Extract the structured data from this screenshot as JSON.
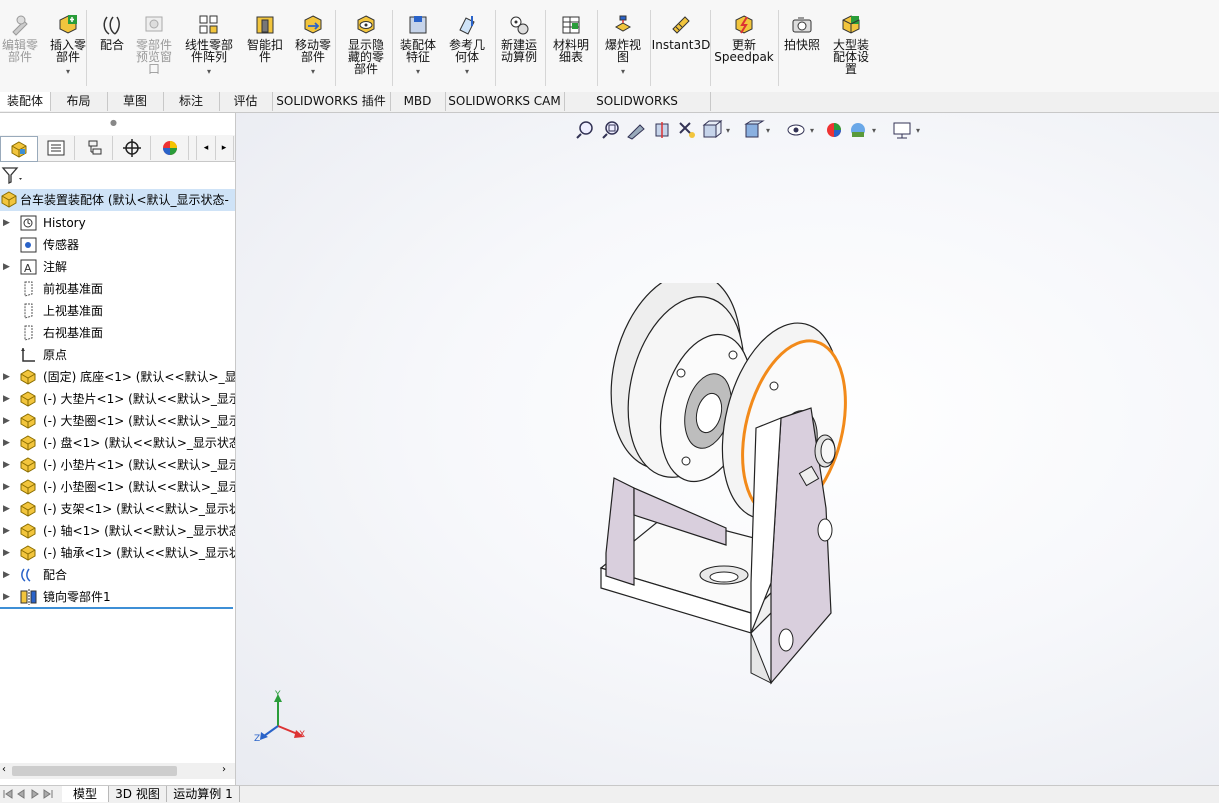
{
  "ribbon": {
    "buttons": [
      {
        "id": "edit-component",
        "label": "编辑零\n部件",
        "disabled": true,
        "caret": false
      },
      {
        "id": "insert-component",
        "label": "插入零\n部件",
        "disabled": false,
        "caret": true
      },
      {
        "id": "mate",
        "label": "配合",
        "disabled": false,
        "caret": false
      },
      {
        "id": "component-preview",
        "label": "零部件\n预览窗\n口",
        "disabled": true,
        "caret": false
      },
      {
        "id": "linear-pattern",
        "label": "线性零部\n件阵列",
        "disabled": false,
        "caret": true
      },
      {
        "id": "smart-fasteners",
        "label": "智能扣\n件",
        "disabled": false,
        "caret": false
      },
      {
        "id": "move-component",
        "label": "移动零\n部件",
        "disabled": false,
        "caret": true
      },
      {
        "id": "show-hidden",
        "label": "显示隐\n藏的零\n部件",
        "disabled": false,
        "caret": false
      },
      {
        "id": "assembly-features",
        "label": "装配体\n特征",
        "disabled": false,
        "caret": true
      },
      {
        "id": "reference-geometry",
        "label": "参考几\n何体",
        "disabled": false,
        "caret": true
      },
      {
        "id": "new-motion-study",
        "label": "新建运\n动算例",
        "disabled": false,
        "caret": false
      },
      {
        "id": "bill-of-materials",
        "label": "材料明\n细表",
        "disabled": false,
        "caret": false
      },
      {
        "id": "exploded-view",
        "label": "爆炸视\n图",
        "disabled": false,
        "caret": true
      },
      {
        "id": "instant3d",
        "label": "Instant3D",
        "disabled": false,
        "caret": false
      },
      {
        "id": "update-speedpak",
        "label": "更新\nSpeedpak",
        "disabled": false,
        "caret": false
      },
      {
        "id": "take-snapshot",
        "label": "拍快照",
        "disabled": false,
        "caret": false
      },
      {
        "id": "large-assembly-settings",
        "label": "大型装\n配体设\n置",
        "disabled": false,
        "caret": false
      }
    ]
  },
  "command_tabs": [
    "装配体",
    "布局",
    "草图",
    "标注",
    "评估",
    "SOLIDWORKS 插件",
    "MBD",
    "SOLIDWORKS CAM",
    "SOLIDWORKS Inspection"
  ],
  "tree": {
    "root": "台车装置装配体  (默认<默认_显示状态-",
    "items": [
      {
        "label": "History",
        "icon": "history-icon",
        "expandable": true
      },
      {
        "label": "传感器",
        "icon": "sensor-icon",
        "expandable": false
      },
      {
        "label": "注解",
        "icon": "annotation-icon",
        "expandable": true
      },
      {
        "label": "前视基准面",
        "icon": "plane-icon",
        "expandable": false
      },
      {
        "label": "上视基准面",
        "icon": "plane-icon",
        "expandable": false
      },
      {
        "label": "右视基准面",
        "icon": "plane-icon",
        "expandable": false
      },
      {
        "label": "原点",
        "icon": "origin-icon",
        "expandable": false
      },
      {
        "label": "(固定) 底座<1> (默认<<默认>_显示",
        "icon": "part-icon",
        "expandable": true
      },
      {
        "label": "(-) 大垫片<1> (默认<<默认>_显示",
        "icon": "part-icon",
        "expandable": true
      },
      {
        "label": "(-) 大垫圈<1> (默认<<默认>_显示",
        "icon": "part-icon",
        "expandable": true
      },
      {
        "label": "(-) 盘<1> (默认<<默认>_显示状态",
        "icon": "part-icon",
        "expandable": true
      },
      {
        "label": "(-) 小垫片<1> (默认<<默认>_显示",
        "icon": "part-icon",
        "expandable": true
      },
      {
        "label": "(-) 小垫圈<1> (默认<<默认>_显示",
        "icon": "part-icon",
        "expandable": true
      },
      {
        "label": "(-) 支架<1> (默认<<默认>_显示状",
        "icon": "part-icon",
        "expandable": true
      },
      {
        "label": "(-) 轴<1> (默认<<默认>_显示状态",
        "icon": "part-icon",
        "expandable": true
      },
      {
        "label": "(-) 轴承<1> (默认<<默认>_显示状",
        "icon": "part-icon",
        "expandable": true
      },
      {
        "label": "配合",
        "icon": "mates-icon",
        "expandable": true
      },
      {
        "label": "镜向零部件1",
        "icon": "mirror-component-icon",
        "expandable": true
      }
    ]
  },
  "bottom_tabs": [
    "模型",
    "3D 视图",
    "运动算例 1"
  ],
  "triad": {
    "x": "X",
    "y": "Y",
    "z": "Z"
  },
  "colors": {
    "selection": "#f28a1a",
    "part_face": "#d9cfdd",
    "tree_selected": "#cfe3f7",
    "accent_blue": "#3d8fd6"
  }
}
